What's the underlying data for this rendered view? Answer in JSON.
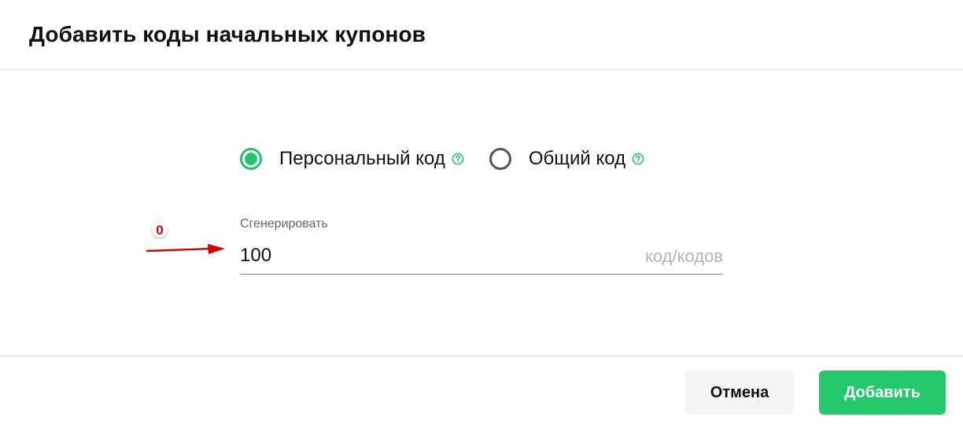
{
  "dialog": {
    "title": "Добавить коды начальных купонов"
  },
  "code_type": {
    "options": [
      {
        "label": "Персональный код",
        "selected": true,
        "help_icon": "question-circle-icon"
      },
      {
        "label": "Общий код",
        "selected": false,
        "help_icon": "question-circle-icon"
      }
    ]
  },
  "generate": {
    "label": "Сгенерировать",
    "value": "100",
    "suffix": "код/кодов"
  },
  "annotation": {
    "marker": "0"
  },
  "footer": {
    "cancel_label": "Отмена",
    "add_label": "Добавить"
  },
  "colors": {
    "accent": "#23c96b",
    "annotation": "#d40000",
    "text": "#111111",
    "muted": "#666666",
    "placeholder": "#b5b5b5"
  }
}
